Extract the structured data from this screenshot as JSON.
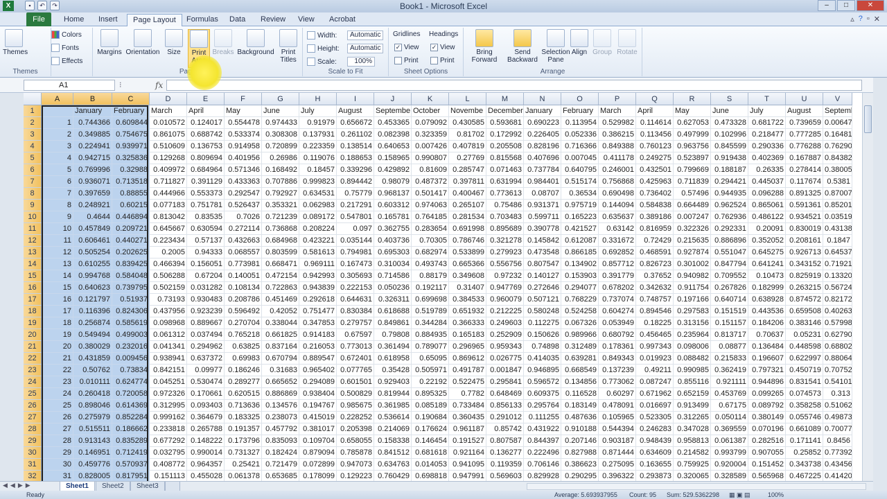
{
  "window": {
    "title": "Book1 - Microsoft Excel"
  },
  "tabs": [
    "File",
    "Home",
    "Insert",
    "Page Layout",
    "Formulas",
    "Data",
    "Review",
    "View",
    "Acrobat"
  ],
  "ribbon": {
    "themes": {
      "label": "Themes",
      "colors": "Colors",
      "fonts": "Fonts",
      "effects": "Effects",
      "group": "Themes"
    },
    "page_setup": {
      "margins": "Margins",
      "orientation": "Orientation",
      "size": "Size",
      "print_area_1": "Print",
      "print_area_2": "Area",
      "breaks": "Breaks",
      "background": "Background",
      "print_titles_1": "Print",
      "print_titles_2": "Titles",
      "group": "Page Setup"
    },
    "scale": {
      "width_label": "Width:",
      "width_value": "Automatic",
      "height_label": "Height:",
      "height_value": "Automatic",
      "scale_label": "Scale:",
      "scale_value": "100%",
      "group": "Scale to Fit"
    },
    "sheet_options": {
      "gridlines": "Gridlines",
      "headings": "Headings",
      "view": "View",
      "print": "Print",
      "group": "Sheet Options"
    },
    "arrange": {
      "bring_1": "Bring",
      "bring_2": "Forward",
      "send_1": "Send",
      "send_2": "Backward",
      "selection_1": "Selection",
      "selection_2": "Pane",
      "align": "Align",
      "group_btn": "Group",
      "rotate": "Rotate",
      "group": "Arrange"
    }
  },
  "formula_bar": {
    "namebox": "A1",
    "fx": "fx",
    "value": ""
  },
  "columns": [
    "A",
    "B",
    "C",
    "D",
    "E",
    "F",
    "G",
    "H",
    "I",
    "J",
    "K",
    "L",
    "M",
    "N",
    "O",
    "P",
    "Q",
    "R",
    "S",
    "T",
    "U",
    "V"
  ],
  "header_row": [
    "",
    "January",
    "February",
    "March",
    "April",
    "May",
    "June",
    "July",
    "August",
    "Septembe",
    "October",
    "Novembe",
    "December",
    "January",
    "February",
    "March",
    "April",
    "May",
    "June",
    "July",
    "August",
    "Septemb"
  ],
  "rows": [
    [
      1,
      "0.744366",
      "0.609844",
      "0.010572",
      "0.124017",
      "0.554478",
      "0.974433",
      "0.91979",
      "0.656672",
      "0.453365",
      "0.079092",
      "0.430585",
      "0.593681",
      "0.690223",
      "0.113954",
      "0.529982",
      "0.114614",
      "0.627053",
      "0.473328",
      "0.681722",
      "0.739659",
      "0.00647"
    ],
    [
      2,
      "0.349885",
      "0.754675",
      "0.861075",
      "0.688742",
      "0.533374",
      "0.308308",
      "0.137931",
      "0.261102",
      "0.082398",
      "0.323359",
      "0.81702",
      "0.172992",
      "0.226405",
      "0.052336",
      "0.386215",
      "0.113456",
      "0.497999",
      "0.102996",
      "0.218477",
      "0.777285",
      "0.16481"
    ],
    [
      3,
      "0.224941",
      "0.939971",
      "0.510609",
      "0.136753",
      "0.914958",
      "0.720899",
      "0.223359",
      "0.138514",
      "0.640653",
      "0.007426",
      "0.407819",
      "0.205508",
      "0.828196",
      "0.716366",
      "0.849388",
      "0.760123",
      "0.963756",
      "0.845599",
      "0.290336",
      "0.776288",
      "0.76290"
    ],
    [
      4,
      "0.942715",
      "0.325836",
      "0.129268",
      "0.809694",
      "0.401956",
      "0.26986",
      "0.119076",
      "0.188653",
      "0.158965",
      "0.990807",
      "0.27769",
      "0.815568",
      "0.407696",
      "0.007045",
      "0.411178",
      "0.249275",
      "0.523897",
      "0.919438",
      "0.402369",
      "0.167887",
      "0.84382"
    ],
    [
      5,
      "0.769996",
      "0.32988",
      "0.409972",
      "0.684964",
      "0.571346",
      "0.168492",
      "0.18457",
      "0.339296",
      "0.429892",
      "0.81609",
      "0.285747",
      "0.071463",
      "0.737784",
      "0.640795",
      "0.246001",
      "0.432501",
      "0.799669",
      "0.188187",
      "0.26335",
      "0.278414",
      "0.38005"
    ],
    [
      6,
      "0.936071",
      "0.713518",
      "0.711827",
      "0.391129",
      "0.433363",
      "0.707886",
      "0.999823",
      "0.894442",
      "0.98079",
      "0.487372",
      "0.397811",
      "0.631994",
      "0.984401",
      "0.515174",
      "0.756868",
      "0.425963",
      "0.711839",
      "0.294421",
      "0.445037",
      "0.117674",
      "0.5381"
    ],
    [
      7,
      "0.397659",
      "0.88855",
      "0.444966",
      "0.553373",
      "0.292547",
      "0.792927",
      "0.634531",
      "0.75779",
      "0.968137",
      "0.501417",
      "0.400467",
      "0.773613",
      "0.08707",
      "0.36534",
      "0.690498",
      "0.736402",
      "0.57496",
      "0.944935",
      "0.096288",
      "0.891325",
      "0.87007"
    ],
    [
      8,
      "0.248921",
      "0.60215",
      "0.077183",
      "0.751781",
      "0.526437",
      "0.353321",
      "0.062983",
      "0.217291",
      "0.603312",
      "0.974063",
      "0.265107",
      "0.75486",
      "0.931371",
      "0.975719",
      "0.144094",
      "0.584838",
      "0.664489",
      "0.962524",
      "0.865061",
      "0.591361",
      "0.85201"
    ],
    [
      9,
      "0.4644",
      "0.446894",
      "0.813042",
      "0.83535",
      "0.7026",
      "0.721239",
      "0.089172",
      "0.547801",
      "0.165781",
      "0.764185",
      "0.281534",
      "0.703483",
      "0.599711",
      "0.165223",
      "0.635637",
      "0.389186",
      "0.007247",
      "0.762936",
      "0.486122",
      "0.934521",
      "0.03519"
    ],
    [
      10,
      "0.457849",
      "0.209721",
      "0.645667",
      "0.630594",
      "0.272114",
      "0.736868",
      "0.208224",
      "0.097",
      "0.362755",
      "0.283654",
      "0.691998",
      "0.895689",
      "0.390778",
      "0.421527",
      "0.63142",
      "0.816959",
      "0.322326",
      "0.292331",
      "0.20091",
      "0.830019",
      "0.43138"
    ],
    [
      11,
      "0.606461",
      "0.440271",
      "0.223434",
      "0.57137",
      "0.432663",
      "0.684968",
      "0.423221",
      "0.035144",
      "0.403736",
      "0.70305",
      "0.786746",
      "0.321278",
      "0.145842",
      "0.612087",
      "0.331672",
      "0.72429",
      "0.215635",
      "0.886896",
      "0.352052",
      "0.208161",
      "0.1847"
    ],
    [
      12,
      "0.505254",
      "0.202625",
      "0.2005",
      "0.94333",
      "0.068557",
      "0.803599",
      "0.581613",
      "0.794981",
      "0.695303",
      "0.682974",
      "0.533899",
      "0.279923",
      "0.473548",
      "0.866185",
      "0.692852",
      "0.468591",
      "0.927874",
      "0.551047",
      "0.645275",
      "0.926713",
      "0.64537"
    ],
    [
      13,
      "0.610255",
      "0.839425",
      "0.466394",
      "0.156051",
      "0.773981",
      "0.668471",
      "0.969111",
      "0.167473",
      "0.310034",
      "0.493743",
      "0.665366",
      "0.556756",
      "0.807547",
      "0.134902",
      "0.857712",
      "0.826723",
      "0.301002",
      "0.847794",
      "0.641241",
      "0.343152",
      "0.71921"
    ],
    [
      14,
      "0.994768",
      "0.584048",
      "0.506288",
      "0.67204",
      "0.140051",
      "0.472154",
      "0.942993",
      "0.305693",
      "0.714586",
      "0.88179",
      "0.349608",
      "0.97232",
      "0.140127",
      "0.153903",
      "0.391779",
      "0.37652",
      "0.940982",
      "0.709552",
      "0.10473",
      "0.825919",
      "0.13320"
    ],
    [
      15,
      "0.640623",
      "0.739795",
      "0.502159",
      "0.031282",
      "0.108134",
      "0.722863",
      "0.943839",
      "0.222153",
      "0.050236",
      "0.192117",
      "0.31407",
      "0.947769",
      "0.272646",
      "0.294077",
      "0.678202",
      "0.342632",
      "0.911754",
      "0.267826",
      "0.182999",
      "0.263215",
      "0.56724"
    ],
    [
      16,
      "0.121797",
      "0.51937",
      "0.73193",
      "0.930483",
      "0.208786",
      "0.451469",
      "0.292618",
      "0.644631",
      "0.326311",
      "0.699698",
      "0.384533",
      "0.960079",
      "0.507121",
      "0.768229",
      "0.737074",
      "0.748757",
      "0.197166",
      "0.640714",
      "0.638928",
      "0.874572",
      "0.82172"
    ],
    [
      17,
      "0.116396",
      "0.824306",
      "0.437956",
      "0.923239",
      "0.596492",
      "0.42052",
      "0.751477",
      "0.830384",
      "0.618688",
      "0.519789",
      "0.651932",
      "0.212225",
      "0.580248",
      "0.524258",
      "0.604274",
      "0.894546",
      "0.297583",
      "0.151519",
      "0.443536",
      "0.659508",
      "0.40263"
    ],
    [
      18,
      "0.256874",
      "0.585619",
      "0.098968",
      "0.889667",
      "0.270704",
      "0.338044",
      "0.347853",
      "0.279757",
      "0.849861",
      "0.344284",
      "0.366333",
      "0.249603",
      "0.112275",
      "0.067326",
      "0.053949",
      "0.18225",
      "0.313156",
      "0.151157",
      "0.184206",
      "0.383146",
      "0.57998"
    ],
    [
      19,
      "0.549494",
      "0.499003",
      "0.061312",
      "0.037494",
      "0.765218",
      "0.661825",
      "0.914183",
      "0.67597",
      "0.79808",
      "0.884935",
      "0.165183",
      "0.252909",
      "0.150626",
      "0.989966",
      "0.680792",
      "0.456465",
      "0.235964",
      "0.813717",
      "0.70637",
      "0.05231",
      "0.62790"
    ],
    [
      20,
      "0.380029",
      "0.232016",
      "0.041341",
      "0.294962",
      "0.63825",
      "0.837164",
      "0.216053",
      "0.773013",
      "0.361494",
      "0.789077",
      "0.296965",
      "0.959343",
      "0.74898",
      "0.312489",
      "0.178361",
      "0.997343",
      "0.098006",
      "0.08877",
      "0.136484",
      "0.448598",
      "0.68802"
    ],
    [
      21,
      "0.431859",
      "0.009456",
      "0.938941",
      "0.637372",
      "0.69983",
      "0.670794",
      "0.889547",
      "0.672401",
      "0.618958",
      "0.65095",
      "0.869612",
      "0.026775",
      "0.414035",
      "0.639281",
      "0.849343",
      "0.019923",
      "0.088482",
      "0.215833",
      "0.196607",
      "0.622997",
      "0.88064"
    ],
    [
      22,
      "0.50762",
      "0.73834",
      "0.842151",
      "0.09977",
      "0.186246",
      "0.31683",
      "0.965402",
      "0.077765",
      "0.35428",
      "0.505971",
      "0.491787",
      "0.001847",
      "0.946895",
      "0.668549",
      "0.137239",
      "0.49211",
      "0.990985",
      "0.362419",
      "0.797321",
      "0.450719",
      "0.70752"
    ],
    [
      23,
      "0.010111",
      "0.624774",
      "0.045251",
      "0.530474",
      "0.289277",
      "0.665652",
      "0.294089",
      "0.601501",
      "0.929403",
      "0.22192",
      "0.522475",
      "0.295841",
      "0.596572",
      "0.134856",
      "0.773062",
      "0.087247",
      "0.855116",
      "0.921111",
      "0.944896",
      "0.831541",
      "0.54101"
    ],
    [
      24,
      "0.260418",
      "0.720058",
      "0.972326",
      "0.170661",
      "0.620515",
      "0.886869",
      "0.938404",
      "0.500829",
      "0.819944",
      "0.895325",
      "0.7782",
      "0.648469",
      "0.609375",
      "0.116528",
      "0.60297",
      "0.671962",
      "0.652159",
      "0.453769",
      "0.099265",
      "0.074573",
      "0.313"
    ],
    [
      25,
      "0.898046",
      "0.614369",
      "0.312995",
      "0.093403",
      "0.713636",
      "0.134576",
      "0.194767",
      "0.985675",
      "0.361985",
      "0.085189",
      "0.733484",
      "0.856133",
      "0.295764",
      "0.183149",
      "0.478091",
      "0.016697",
      "0.913499",
      "0.67175",
      "0.089792",
      "0.358258",
      "0.51062"
    ],
    [
      26,
      "0.275979",
      "0.852284",
      "0.999162",
      "0.364679",
      "0.183325",
      "0.238073",
      "0.415019",
      "0.228252",
      "0.536614",
      "0.190684",
      "0.360435",
      "0.291012",
      "0.111255",
      "0.487636",
      "0.105965",
      "0.523305",
      "0.312265",
      "0.050114",
      "0.380149",
      "0.055746",
      "0.49873"
    ],
    [
      27,
      "0.515511",
      "0.186662",
      "0.233818",
      "0.265788",
      "0.191357",
      "0.457792",
      "0.381017",
      "0.205398",
      "0.214069",
      "0.176624",
      "0.961187",
      "0.85742",
      "0.431922",
      "0.910188",
      "0.544394",
      "0.246283",
      "0.347028",
      "0.369559",
      "0.070196",
      "0.661089",
      "0.70077"
    ],
    [
      28,
      "0.913143",
      "0.835289",
      "0.677292",
      "0.148222",
      "0.173796",
      "0.835093",
      "0.109704",
      "0.658055",
      "0.158338",
      "0.146454",
      "0.191527",
      "0.807587",
      "0.844397",
      "0.207146",
      "0.903187",
      "0.948439",
      "0.958813",
      "0.061387",
      "0.282516",
      "0.171141",
      "0.8456"
    ],
    [
      29,
      "0.146951",
      "0.712419",
      "0.032795",
      "0.990014",
      "0.731327",
      "0.182424",
      "0.879094",
      "0.785878",
      "0.841512",
      "0.681618",
      "0.921164",
      "0.136277",
      "0.222496",
      "0.827988",
      "0.871444",
      "0.634609",
      "0.214582",
      "0.993799",
      "0.907055",
      "0.25852",
      "0.77392"
    ],
    [
      30,
      "0.459776",
      "0.570937",
      "0.408772",
      "0.964357",
      "0.25421",
      "0.721479",
      "0.072899",
      "0.947073",
      "0.634763",
      "0.014053",
      "0.941095",
      "0.119359",
      "0.706146",
      "0.386623",
      "0.275095",
      "0.163655",
      "0.759925",
      "0.920004",
      "0.151452",
      "0.343738",
      "0.43456"
    ],
    [
      31,
      "0.828005",
      "0.817951",
      "0.151113",
      "0.455028",
      "0.061378",
      "0.653685",
      "0.178099",
      "0.129223",
      "0.760429",
      "0.698818",
      "0.947991",
      "0.569603",
      "0.829928",
      "0.290295",
      "0.396322",
      "0.293873",
      "0.320065",
      "0.328589",
      "0.565968",
      "0.467225",
      "0.41420"
    ]
  ],
  "sheets": [
    "Sheet1",
    "Sheet2",
    "Sheet3"
  ],
  "status": {
    "ready": "Ready",
    "average": "Average: 5.693937955",
    "count": "Count: 95",
    "sum": "Sum: 529.5362298",
    "zoom": "100%"
  }
}
